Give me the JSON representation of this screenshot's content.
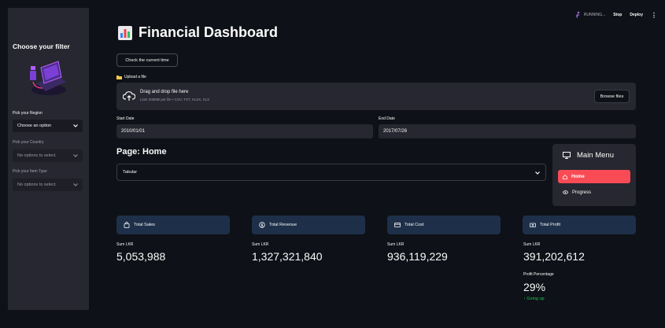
{
  "header": {
    "status": "RUNNING...",
    "stop": "Stop",
    "deploy": "Deploy",
    "more": "⋮"
  },
  "sidebar": {
    "title": "Choose your filter",
    "filters": [
      {
        "label": "Pick your Region",
        "value": "Choose an option"
      },
      {
        "label": "Pick your Country",
        "value": "No options to select."
      },
      {
        "label": "Pick your Item Type",
        "value": "No options to select."
      }
    ]
  },
  "main": {
    "title": "Financial Dashboard",
    "time_button": "Check the current time",
    "upload": {
      "label": "Upload a file",
      "drop_text": "Drag and drop file here",
      "limit_text": "Limit 200MB per file • CSV, TXT, XLSX, XLS",
      "browse": "Browse files"
    },
    "start_date": {
      "label": "Start Date",
      "value": "2010/01/01"
    },
    "end_date": {
      "label": "End Date",
      "value": "2017/07/26"
    },
    "page_title": "Page: Home",
    "view_select": "Tabular"
  },
  "menu": {
    "title": "Main Menu",
    "items": [
      {
        "label": "Home"
      },
      {
        "label": "Progress"
      }
    ]
  },
  "metrics": [
    {
      "card": "Total Sales",
      "label": "Sum LKR",
      "value": "5,053,988"
    },
    {
      "card": "Total Revenue",
      "label": "Sum LKR",
      "value": "1,327,321,840"
    },
    {
      "card": "Total Cost",
      "label": "Sum LKR",
      "value": "936,119,229"
    },
    {
      "card": "Total Profit",
      "label": "Sum LKR",
      "value": "391,202,612"
    }
  ],
  "profit_percentage": {
    "label": "Profit Percentage",
    "value": "29%",
    "delta": "Going up"
  },
  "colors": {
    "accent": "#f94b55",
    "card": "#1e3049",
    "positive": "#21c354",
    "bg": "#0e1117",
    "panel": "#262730"
  }
}
